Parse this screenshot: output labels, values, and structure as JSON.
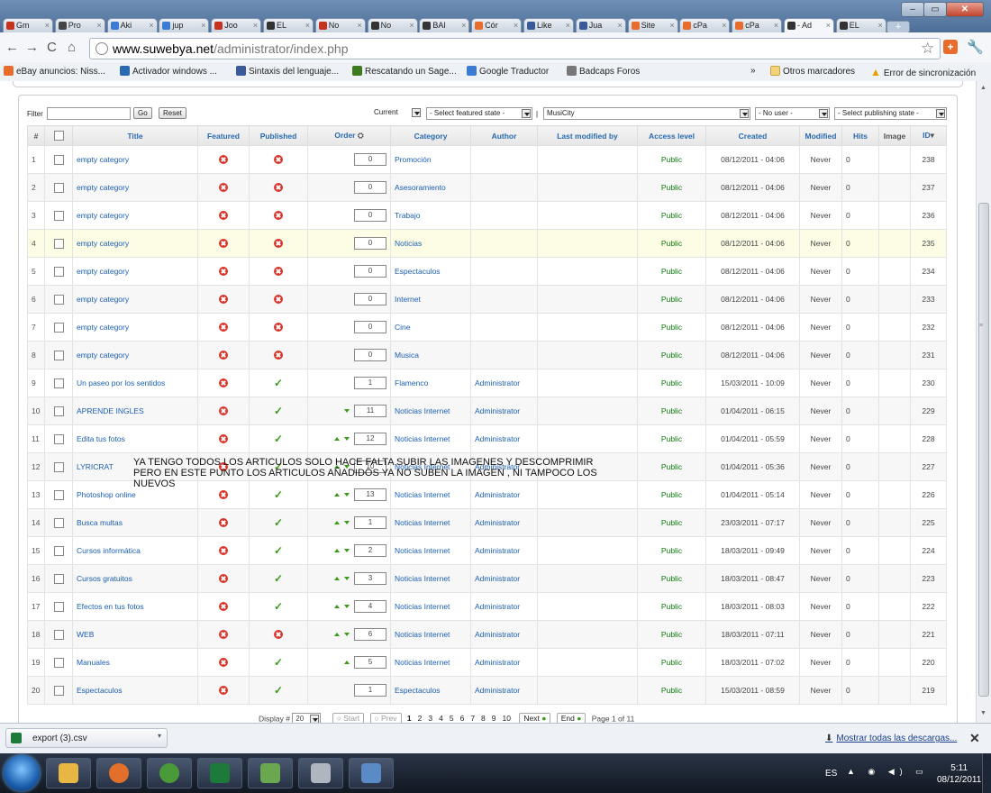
{
  "browser": {
    "tabs": [
      {
        "label": "Gm",
        "color": "#c5321e"
      },
      {
        "label": "Pro",
        "color": "#444444"
      },
      {
        "label": "Aki",
        "color": "#3a7bd5"
      },
      {
        "label": "jup",
        "color": "#3a7bd5"
      },
      {
        "label": "Joo",
        "color": "#c5321e"
      },
      {
        "label": "EL",
        "color": "#333333"
      },
      {
        "label": "No",
        "color": "#c5321e"
      },
      {
        "label": "No",
        "color": "#333333"
      },
      {
        "label": "BAI",
        "color": "#333333"
      },
      {
        "label": "Cór",
        "color": "#e86c2c"
      },
      {
        "label": "Like",
        "color": "#3b5998"
      },
      {
        "label": "Jua",
        "color": "#3b5998"
      },
      {
        "label": "Site",
        "color": "#e86c2c"
      },
      {
        "label": "cPa",
        "color": "#e86c2c"
      },
      {
        "label": "cPa",
        "color": "#e86c2c"
      },
      {
        "label": "- Ad",
        "color": "#333333"
      },
      {
        "label": "EL",
        "color": "#333333"
      }
    ],
    "url_domain": "www.suwebya.net",
    "url_path": "/administrator/index.php",
    "bookmarks": [
      {
        "label": "eBay anuncios: Niss...",
        "color": "#e86c2c"
      },
      {
        "label": "Activador windows ...",
        "color": "#2a6ab0"
      },
      {
        "label": "Sintaxis del lenguaje...",
        "color": "#3a5a99"
      },
      {
        "label": "Rescatando un Sage...",
        "color": "#3b7a1e"
      },
      {
        "label": "Google Traductor",
        "color": "#3a7bd5"
      },
      {
        "label": "Badcaps Foros",
        "color": "#777777"
      }
    ],
    "bookmarks_more": "»",
    "other_bookmarks": "Otros marcadores",
    "sync_error": "Error de sincronización"
  },
  "filters": {
    "filter_label": "Filter",
    "filter_value": "",
    "go": "Go",
    "reset": "Reset",
    "current": "Current",
    "featured_state": "- Select featured state -",
    "separator": "|",
    "category": "MusiCity",
    "user": "- No user -",
    "publishing_state": "- Select publishing state -"
  },
  "table": {
    "headers": {
      "num": "#",
      "title": "Title",
      "featured": "Featured",
      "published": "Published",
      "order": "Order",
      "category": "Category",
      "author": "Author",
      "last_modified_by": "Last modified by",
      "access": "Access level",
      "created": "Created",
      "modified": "Modified",
      "hits": "Hits",
      "image": "Image",
      "id": "ID"
    },
    "rows": [
      {
        "num": "1",
        "title": "empty category",
        "featured": false,
        "published": false,
        "up": false,
        "down": false,
        "order": "0",
        "category": "Promoción",
        "author": "",
        "lmb": "",
        "access": "Public",
        "created": "08/12/2011 - 04:06",
        "modified": "Never",
        "hits": "0",
        "image": "",
        "id": "238"
      },
      {
        "num": "2",
        "title": "empty category",
        "featured": false,
        "published": false,
        "up": false,
        "down": false,
        "order": "0",
        "category": "Asesoramiento",
        "author": "",
        "lmb": "",
        "access": "Public",
        "created": "08/12/2011 - 04:06",
        "modified": "Never",
        "hits": "0",
        "image": "",
        "id": "237"
      },
      {
        "num": "3",
        "title": "empty category",
        "featured": false,
        "published": false,
        "up": false,
        "down": false,
        "order": "0",
        "category": "Trabajo",
        "author": "",
        "lmb": "",
        "access": "Public",
        "created": "08/12/2011 - 04:06",
        "modified": "Never",
        "hits": "0",
        "image": "",
        "id": "236"
      },
      {
        "num": "4",
        "title": "empty category",
        "featured": false,
        "published": false,
        "up": false,
        "down": false,
        "order": "0",
        "category": "Noticias",
        "author": "",
        "lmb": "",
        "access": "Public",
        "created": "08/12/2011 - 04:06",
        "modified": "Never",
        "hits": "0",
        "image": "",
        "id": "235"
      },
      {
        "num": "5",
        "title": "empty category",
        "featured": false,
        "published": false,
        "up": false,
        "down": false,
        "order": "0",
        "category": "Espectaculos",
        "author": "",
        "lmb": "",
        "access": "Public",
        "created": "08/12/2011 - 04:06",
        "modified": "Never",
        "hits": "0",
        "image": "",
        "id": "234"
      },
      {
        "num": "6",
        "title": "empty category",
        "featured": false,
        "published": false,
        "up": false,
        "down": false,
        "order": "0",
        "category": "Internet",
        "author": "",
        "lmb": "",
        "access": "Public",
        "created": "08/12/2011 - 04:06",
        "modified": "Never",
        "hits": "0",
        "image": "",
        "id": "233"
      },
      {
        "num": "7",
        "title": "empty category",
        "featured": false,
        "published": false,
        "up": false,
        "down": false,
        "order": "0",
        "category": "Cine",
        "author": "",
        "lmb": "",
        "access": "Public",
        "created": "08/12/2011 - 04:06",
        "modified": "Never",
        "hits": "0",
        "image": "",
        "id": "232"
      },
      {
        "num": "8",
        "title": "empty category",
        "featured": false,
        "published": false,
        "up": false,
        "down": false,
        "order": "0",
        "category": "Musica",
        "author": "",
        "lmb": "",
        "access": "Public",
        "created": "08/12/2011 - 04:06",
        "modified": "Never",
        "hits": "0",
        "image": "",
        "id": "231"
      },
      {
        "num": "9",
        "title": "Un paseo por los sentidos",
        "featured": false,
        "published": true,
        "up": false,
        "down": false,
        "order": "1",
        "category": "Flamenco",
        "author": "Administrator",
        "lmb": "",
        "access": "Public",
        "created": "15/03/2011 - 10:09",
        "modified": "Never",
        "hits": "0",
        "image": "",
        "id": "230"
      },
      {
        "num": "10",
        "title": "APRENDE INGLES",
        "featured": false,
        "published": true,
        "up": false,
        "down": true,
        "order": "11",
        "category": "Noticias Internet",
        "author": "Administrator",
        "lmb": "",
        "access": "Public",
        "created": "01/04/2011 - 06:15",
        "modified": "Never",
        "hits": "0",
        "image": "",
        "id": "229"
      },
      {
        "num": "11",
        "title": "Edita tus fotos",
        "featured": false,
        "published": true,
        "up": true,
        "down": true,
        "order": "12",
        "category": "Noticias Internet",
        "author": "Administrator",
        "lmb": "",
        "access": "Public",
        "created": "01/04/2011 - 05:59",
        "modified": "Never",
        "hits": "0",
        "image": "",
        "id": "228"
      },
      {
        "num": "12",
        "title": "LYRICRAT",
        "featured": false,
        "published": true,
        "up": true,
        "down": true,
        "order": "10",
        "category": "Noticias Internet",
        "author": "Administrator",
        "lmb": "",
        "access": "Public",
        "created": "01/04/2011 - 05:36",
        "modified": "Never",
        "hits": "0",
        "image": "",
        "id": "227"
      },
      {
        "num": "13",
        "title": "Photoshop online",
        "featured": false,
        "published": true,
        "up": true,
        "down": true,
        "order": "13",
        "category": "Noticias Internet",
        "author": "Administrator",
        "lmb": "",
        "access": "Public",
        "created": "01/04/2011 - 05:14",
        "modified": "Never",
        "hits": "0",
        "image": "",
        "id": "226"
      },
      {
        "num": "14",
        "title": "Busca multas",
        "featured": false,
        "published": true,
        "up": true,
        "down": true,
        "order": "1",
        "category": "Noticias Internet",
        "author": "Administrator",
        "lmb": "",
        "access": "Public",
        "created": "23/03/2011 - 07:17",
        "modified": "Never",
        "hits": "0",
        "image": "",
        "id": "225"
      },
      {
        "num": "15",
        "title": "Cursos informática",
        "featured": false,
        "published": true,
        "up": true,
        "down": true,
        "order": "2",
        "category": "Noticias Internet",
        "author": "Administrator",
        "lmb": "",
        "access": "Public",
        "created": "18/03/2011 - 09:49",
        "modified": "Never",
        "hits": "0",
        "image": "",
        "id": "224"
      },
      {
        "num": "16",
        "title": "Cursos gratuitos",
        "featured": false,
        "published": true,
        "up": true,
        "down": true,
        "order": "3",
        "category": "Noticias Internet",
        "author": "Administrator",
        "lmb": "",
        "access": "Public",
        "created": "18/03/2011 - 08:47",
        "modified": "Never",
        "hits": "0",
        "image": "",
        "id": "223"
      },
      {
        "num": "17",
        "title": "Efectos en tus fotos",
        "featured": false,
        "published": true,
        "up": true,
        "down": true,
        "order": "4",
        "category": "Noticias Internet",
        "author": "Administrator",
        "lmb": "",
        "access": "Public",
        "created": "18/03/2011 - 08:03",
        "modified": "Never",
        "hits": "0",
        "image": "",
        "id": "222"
      },
      {
        "num": "18",
        "title": "WEB",
        "featured": false,
        "published": false,
        "up": true,
        "down": true,
        "order": "6",
        "category": "Noticias Internet",
        "author": "Administrator",
        "lmb": "",
        "access": "Public",
        "created": "18/03/2011 - 07:11",
        "modified": "Never",
        "hits": "0",
        "image": "",
        "id": "221"
      },
      {
        "num": "19",
        "title": "Manuales",
        "featured": false,
        "published": true,
        "up": true,
        "down": false,
        "order": "5",
        "category": "Noticias Internet",
        "author": "Administrator",
        "lmb": "",
        "access": "Public",
        "created": "18/03/2011 - 07:02",
        "modified": "Never",
        "hits": "0",
        "image": "",
        "id": "220"
      },
      {
        "num": "20",
        "title": "Espectaculos",
        "featured": false,
        "published": true,
        "up": false,
        "down": false,
        "order": "1",
        "category": "Espectaculos",
        "author": "Administrator",
        "lmb": "",
        "access": "Public",
        "created": "15/03/2011 - 08:59",
        "modified": "Never",
        "hits": "0",
        "image": "",
        "id": "219"
      }
    ]
  },
  "note": {
    "line1": "YA TENGO TODOS LOS ARTICULOS SOLO HACE FALTA SUBIR LAS IMAGENES Y DESCOMPRIMIR",
    "line2": "PERO EN ESTE PUNTO LOS ARTICULOS AÑADIDOS YA NO SUBEN LA IMAGEN , NI TAMPOCO LOS",
    "line3": "NUEVOS"
  },
  "pager": {
    "display_label": "Display #",
    "display_value": "20",
    "start": "Start",
    "prev": "Prev",
    "pages": [
      "1",
      "2",
      "3",
      "4",
      "5",
      "6",
      "7",
      "8",
      "9",
      "10"
    ],
    "next": "Next",
    "end": "End",
    "page_of": "Page 1 of 11"
  },
  "downloads": {
    "file": "export (3).csv",
    "show_all": "Mostrar todas las descargas...",
    "close": "✕"
  },
  "taskbar": {
    "apps": [
      {
        "name": "explorer",
        "color": "#e8b642"
      },
      {
        "name": "firefox",
        "color": "#e2702b"
      },
      {
        "name": "chrome",
        "color": "#4a9a3a"
      },
      {
        "name": "excel",
        "color": "#1e7a3a"
      },
      {
        "name": "chart-app",
        "color": "#6aa84f"
      },
      {
        "name": "editor",
        "color": "#b0b6c0"
      },
      {
        "name": "notes",
        "color": "#5a8bc7"
      }
    ],
    "lang": "ES",
    "time": "5:11",
    "date": "08/12/2011"
  }
}
